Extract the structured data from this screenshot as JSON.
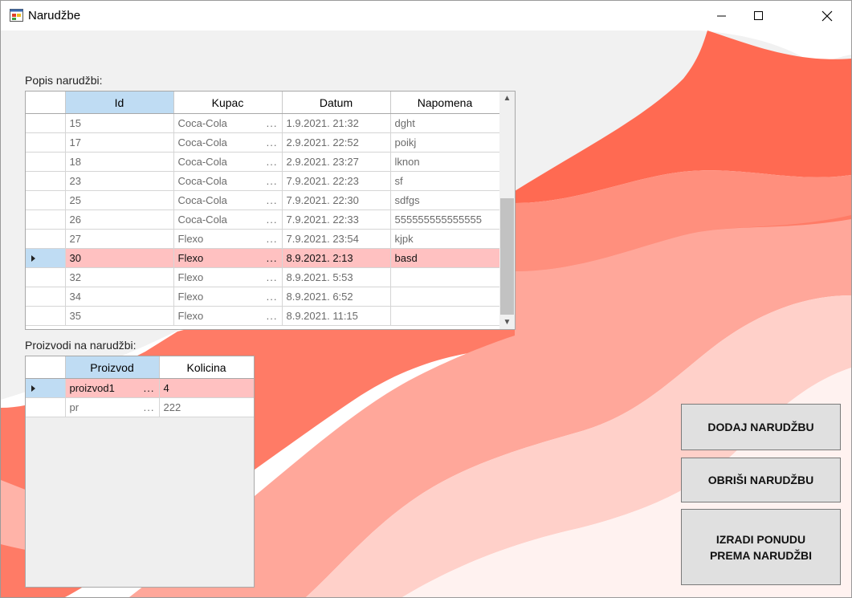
{
  "window": {
    "title": "Narudžbe"
  },
  "orders": {
    "label": "Popis narudžbi:",
    "columns": [
      "Id",
      "Kupac",
      "Datum",
      "Napomena"
    ],
    "rows": [
      {
        "id": "15",
        "kupac": "Coca-Cola",
        "datum": "1.9.2021. 21:32",
        "napomena": "dght"
      },
      {
        "id": "17",
        "kupac": "Coca-Cola",
        "datum": "2.9.2021. 22:52",
        "napomena": "poikj"
      },
      {
        "id": "18",
        "kupac": "Coca-Cola",
        "datum": "2.9.2021. 23:27",
        "napomena": "lknon"
      },
      {
        "id": "23",
        "kupac": "Coca-Cola",
        "datum": "7.9.2021. 22:23",
        "napomena": "sf"
      },
      {
        "id": "25",
        "kupac": "Coca-Cola",
        "datum": "7.9.2021. 22:30",
        "napomena": "sdfgs"
      },
      {
        "id": "26",
        "kupac": "Coca-Cola",
        "datum": "7.9.2021. 22:33",
        "napomena": "555555555555555"
      },
      {
        "id": "27",
        "kupac": "Flexo",
        "datum": "7.9.2021. 23:54",
        "napomena": "kjpk"
      },
      {
        "id": "30",
        "kupac": "Flexo",
        "datum": "8.9.2021. 2:13",
        "napomena": "basd"
      },
      {
        "id": "32",
        "kupac": "Flexo",
        "datum": "8.9.2021. 5:53",
        "napomena": ""
      },
      {
        "id": "34",
        "kupac": "Flexo",
        "datum": "8.9.2021. 6:52",
        "napomena": ""
      },
      {
        "id": "35",
        "kupac": "Flexo",
        "datum": "8.9.2021. 11:15",
        "napomena": ""
      }
    ],
    "selected_index": 7
  },
  "products": {
    "label": "Proizvodi na narudžbi:",
    "columns": [
      "Proizvod",
      "Kolicina"
    ],
    "rows": [
      {
        "proizvod": "proizvod1",
        "kolicina": "4"
      },
      {
        "proizvod": "pr",
        "kolicina": "222"
      }
    ],
    "selected_index": 0
  },
  "ellipsis": "...",
  "buttons": {
    "add": "DODAJ NARUDŽBU",
    "delete": "OBRIŠI NARUDŽBU",
    "offer": "IZRADI PONUDU PREMA NARUDŽBI"
  },
  "icons": {
    "app": "app-window-icon",
    "minimize": "minimize-icon",
    "maximize": "maximize-icon",
    "close": "close-icon",
    "row_indicator": "row-pointer-icon",
    "scroll_up": "chevron-up-icon",
    "scroll_down": "chevron-down-icon"
  },
  "colors": {
    "accent_red": "#ff6a52",
    "selected_row": "#ffc1c1",
    "selected_header": "#bfdcf3"
  }
}
